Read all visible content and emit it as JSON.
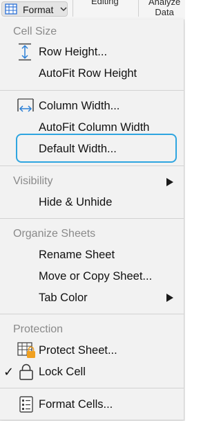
{
  "ribbon": {
    "format_label": "Format",
    "editing_label": "Editing",
    "analyze_line1": "Analyze",
    "analyze_line2": "Data"
  },
  "menu": {
    "cell_size": {
      "header": "Cell Size",
      "row_height": "Row Height...",
      "autofit_row_height": "AutoFit Row Height",
      "column_width": "Column Width...",
      "autofit_column_width": "AutoFit Column Width",
      "default_width": "Default Width..."
    },
    "visibility": {
      "header": "Visibility",
      "hide_unhide": "Hide & Unhide"
    },
    "organize_sheets": {
      "header": "Organize Sheets",
      "rename_sheet": "Rename Sheet",
      "move_copy_sheet": "Move or Copy Sheet...",
      "tab_color": "Tab Color"
    },
    "protection": {
      "header": "Protection",
      "protect_sheet": "Protect Sheet...",
      "lock_cell": "Lock Cell",
      "lock_cell_checked": true
    },
    "format_cells": "Format Cells..."
  },
  "colors": {
    "highlight": "#2ea5e0",
    "menu_bg": "#f2f2f2",
    "section_header": "#8a8a8a",
    "lock_accent": "#f0a020"
  }
}
